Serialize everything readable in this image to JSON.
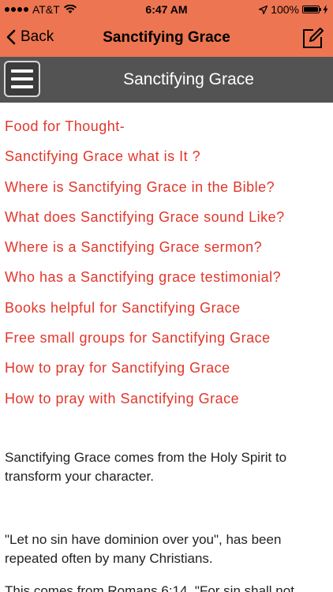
{
  "status_bar": {
    "carrier": "AT&T",
    "time": "6:47 AM",
    "battery": "100%"
  },
  "nav": {
    "back_label": "Back",
    "title": "Sanctifying Grace"
  },
  "sub_header": {
    "title": "Sanctifying Grace"
  },
  "links": [
    "Food for Thought-",
    "Sanctifying Grace what is It ?",
    "Where is Sanctifying Grace in the Bible?",
    "What does Sanctifying Grace sound Like?",
    "Where is a Sanctifying Grace sermon?",
    "Who has a Sanctifying grace testimonial?",
    "Books helpful for Sanctifying Grace",
    "Free small groups for Sanctifying Grace",
    "How to pray for Sanctifying Grace",
    "How to pray with Sanctifying Grace"
  ],
  "paragraphs": [
    "Sanctifying Grace comes from the Holy Spirit to transform your character.",
    "\"Let no sin have dominion over you\", has been repeated often by many Christians.",
    " This comes from Romans 6:14, \"For sin shall not"
  ],
  "colors": {
    "header": "#ed7551",
    "sub_header": "#535353",
    "link": "#e2362b"
  }
}
